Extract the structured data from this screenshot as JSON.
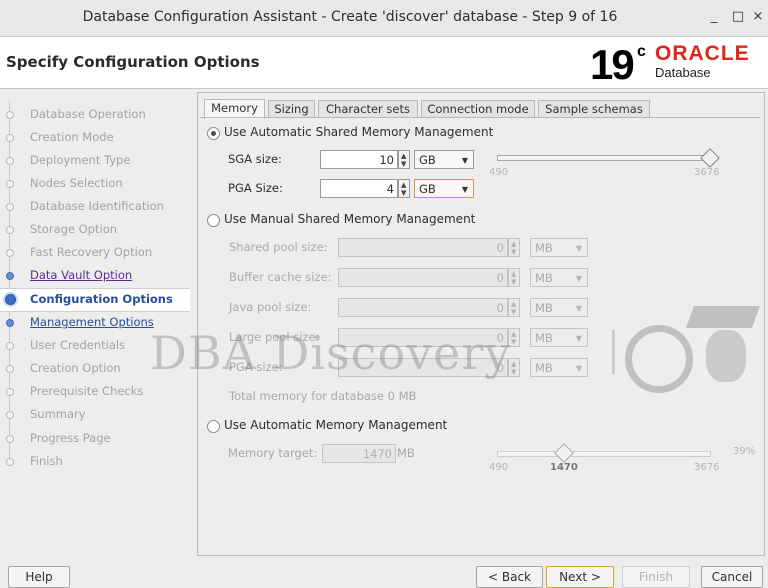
{
  "window": {
    "title": "Database Configuration Assistant - Create 'discover' database - Step 9 of 16",
    "minimize_glyph": "_",
    "maximize_glyph": "□",
    "close_glyph": "×"
  },
  "header": {
    "page_title": "Specify Configuration Options",
    "logo_version": "19",
    "logo_version_sup": "c",
    "logo_brand": "ORACLE",
    "logo_product": "Database"
  },
  "steps": [
    {
      "label": "Database Operation",
      "state": "done"
    },
    {
      "label": "Creation Mode",
      "state": "done"
    },
    {
      "label": "Deployment Type",
      "state": "done"
    },
    {
      "label": "Nodes Selection",
      "state": "done"
    },
    {
      "label": "Database Identification",
      "state": "done"
    },
    {
      "label": "Storage Option",
      "state": "done"
    },
    {
      "label": "Fast Recovery Option",
      "state": "done"
    },
    {
      "label": "Data Vault Option",
      "state": "link-visited"
    },
    {
      "label": "Configuration Options",
      "state": "current"
    },
    {
      "label": "Management Options",
      "state": "link"
    },
    {
      "label": "User Credentials",
      "state": "pending"
    },
    {
      "label": "Creation Option",
      "state": "pending"
    },
    {
      "label": "Prerequisite Checks",
      "state": "pending"
    },
    {
      "label": "Summary",
      "state": "pending"
    },
    {
      "label": "Progress Page",
      "state": "pending"
    },
    {
      "label": "Finish",
      "state": "pending"
    }
  ],
  "tabs": [
    {
      "label": "Memory",
      "selected": true
    },
    {
      "label": "Sizing",
      "selected": false
    },
    {
      "label": "Character sets",
      "selected": false
    },
    {
      "label": "Connection mode",
      "selected": false
    },
    {
      "label": "Sample schemas",
      "selected": false
    }
  ],
  "asmm": {
    "option_label": "Use Automatic Shared Memory Management",
    "selected": true,
    "sga_label": "SGA size:",
    "sga_value": "10",
    "sga_unit": "GB",
    "pga_label": "PGA Size:",
    "pga_value": "4",
    "pga_unit": "GB",
    "slider_min": "490",
    "slider_max": "3676"
  },
  "manual": {
    "option_label": "Use Manual Shared Memory Management",
    "selected": false,
    "fields": [
      {
        "label": "Shared pool size:",
        "value": "0",
        "unit": "MB"
      },
      {
        "label": "Buffer cache size:",
        "value": "0",
        "unit": "MB"
      },
      {
        "label": "Java pool size:",
        "value": "0",
        "unit": "MB"
      },
      {
        "label": "Large pool size:",
        "value": "0",
        "unit": "MB"
      },
      {
        "label": "PGA size:",
        "value": "0",
        "unit": "MB"
      }
    ],
    "total_text": "Total memory for database 0 MB"
  },
  "amm": {
    "option_label": "Use Automatic Memory Management",
    "selected": false,
    "target_label": "Memory target:",
    "target_value": "1470",
    "target_unit": "MB",
    "slider_min": "490",
    "slider_value": "1470",
    "slider_max": "3676",
    "percent": "39%"
  },
  "watermark": {
    "text": "DBA Discovery"
  },
  "buttons": {
    "help": "Help",
    "back": "< Back",
    "next": "Next >",
    "finish": "Finish",
    "cancel": "Cancel"
  },
  "colors": {
    "accent": "#2a4d9b",
    "visited_link": "#5a2e91",
    "oracle_red": "#e2231a",
    "focus": "#e0a030"
  }
}
